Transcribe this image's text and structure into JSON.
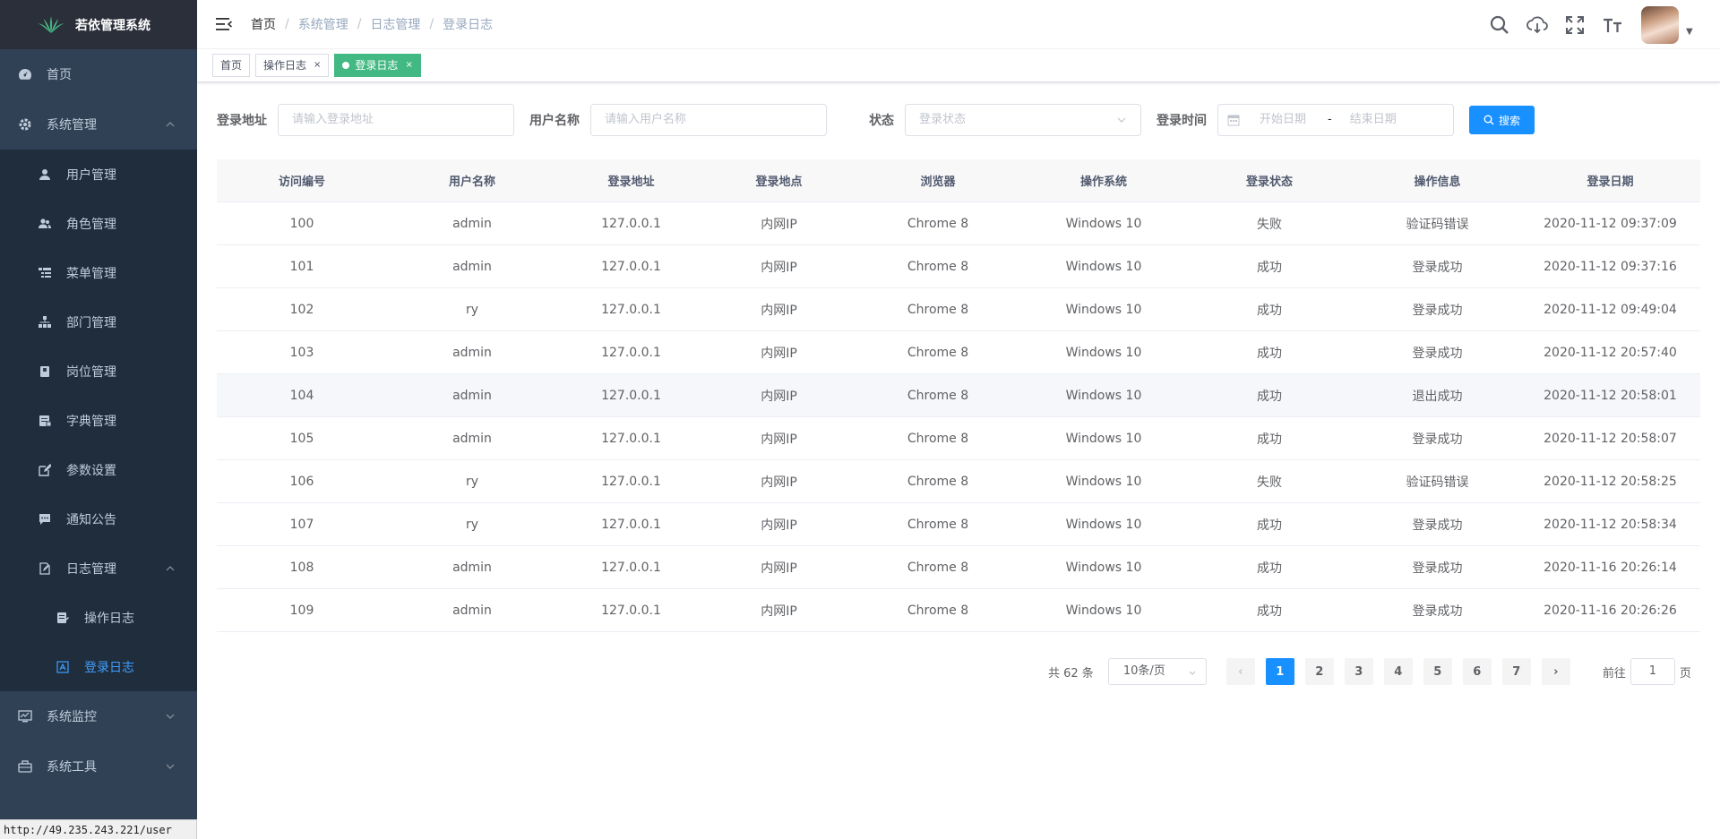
{
  "app": {
    "title": "若依管理系统"
  },
  "sidebar": {
    "items": [
      {
        "label": "首页",
        "icon": "dashboard-icon"
      },
      {
        "label": "系统管理",
        "icon": "gear-icon",
        "expanded": true,
        "children": [
          {
            "label": "用户管理",
            "icon": "user-icon"
          },
          {
            "label": "角色管理",
            "icon": "peoples-icon"
          },
          {
            "label": "菜单管理",
            "icon": "tree-table-icon"
          },
          {
            "label": "部门管理",
            "icon": "tree-icon"
          },
          {
            "label": "岗位管理",
            "icon": "post-icon"
          },
          {
            "label": "字典管理",
            "icon": "dict-icon"
          },
          {
            "label": "参数设置",
            "icon": "edit-icon"
          },
          {
            "label": "通知公告",
            "icon": "message-icon"
          },
          {
            "label": "日志管理",
            "icon": "log-icon",
            "expanded": true,
            "children": [
              {
                "label": "操作日志",
                "icon": "form-icon"
              },
              {
                "label": "登录日志",
                "icon": "logininfor-icon",
                "active": true
              }
            ]
          }
        ]
      },
      {
        "label": "系统监控",
        "icon": "monitor-icon"
      },
      {
        "label": "系统工具",
        "icon": "tool-icon"
      }
    ]
  },
  "status_url": "http://49.235.243.221/user",
  "breadcrumb": [
    "首页",
    "系统管理",
    "日志管理",
    "登录日志"
  ],
  "header_tools": [
    "search-icon",
    "cloud-download-icon",
    "fullscreen-icon",
    "font-size-icon"
  ],
  "tags": [
    {
      "label": "首页",
      "closable": false,
      "active": false
    },
    {
      "label": "操作日志",
      "closable": true,
      "active": false
    },
    {
      "label": "登录日志",
      "closable": true,
      "active": true
    }
  ],
  "tag_close": "×",
  "search": {
    "ipaddr": {
      "label": "登录地址",
      "placeholder": "请输入登录地址"
    },
    "username": {
      "label": "用户名称",
      "placeholder": "请输入用户名称"
    },
    "status": {
      "label": "状态",
      "placeholder": "登录状态"
    },
    "time": {
      "label": "登录时间",
      "start": "开始日期",
      "sep": "-",
      "end": "结束日期"
    },
    "button": "搜索"
  },
  "table": {
    "headers": [
      "访问编号",
      "用户名称",
      "登录地址",
      "登录地点",
      "浏览器",
      "操作系统",
      "登录状态",
      "操作信息",
      "登录日期"
    ],
    "rows": [
      [
        "100",
        "admin",
        "127.0.0.1",
        "内网IP",
        "Chrome 8",
        "Windows 10",
        "失败",
        "验证码错误",
        "2020-11-12 09:37:09"
      ],
      [
        "101",
        "admin",
        "127.0.0.1",
        "内网IP",
        "Chrome 8",
        "Windows 10",
        "成功",
        "登录成功",
        "2020-11-12 09:37:16"
      ],
      [
        "102",
        "ry",
        "127.0.0.1",
        "内网IP",
        "Chrome 8",
        "Windows 10",
        "成功",
        "登录成功",
        "2020-11-12 09:49:04"
      ],
      [
        "103",
        "admin",
        "127.0.0.1",
        "内网IP",
        "Chrome 8",
        "Windows 10",
        "成功",
        "登录成功",
        "2020-11-12 20:57:40"
      ],
      [
        "104",
        "admin",
        "127.0.0.1",
        "内网IP",
        "Chrome 8",
        "Windows 10",
        "成功",
        "退出成功",
        "2020-11-12 20:58:01"
      ],
      [
        "105",
        "admin",
        "127.0.0.1",
        "内网IP",
        "Chrome 8",
        "Windows 10",
        "成功",
        "登录成功",
        "2020-11-12 20:58:07"
      ],
      [
        "106",
        "ry",
        "127.0.0.1",
        "内网IP",
        "Chrome 8",
        "Windows 10",
        "失败",
        "验证码错误",
        "2020-11-12 20:58:25"
      ],
      [
        "107",
        "ry",
        "127.0.0.1",
        "内网IP",
        "Chrome 8",
        "Windows 10",
        "成功",
        "登录成功",
        "2020-11-12 20:58:34"
      ],
      [
        "108",
        "admin",
        "127.0.0.1",
        "内网IP",
        "Chrome 8",
        "Windows 10",
        "成功",
        "登录成功",
        "2020-11-16 20:26:14"
      ],
      [
        "109",
        "admin",
        "127.0.0.1",
        "内网IP",
        "Chrome 8",
        "Windows 10",
        "成功",
        "登录成功",
        "2020-11-16 20:26:26"
      ]
    ],
    "hover_row": 4
  },
  "pagination": {
    "total_text": "共 62 条",
    "page_size": "10条/页",
    "pages": [
      "1",
      "2",
      "3",
      "4",
      "5",
      "6",
      "7"
    ],
    "current": 1,
    "prev": "‹",
    "next": "›",
    "goto_label": "前往",
    "goto_value": "1",
    "goto_suffix": "页"
  },
  "colors": {
    "sidebar_bg": "#304156",
    "sidebar_sub_bg": "#1f2d3d",
    "active_menu": "#409eff",
    "tag_active": "#42b983",
    "primary": "#1890ff"
  }
}
